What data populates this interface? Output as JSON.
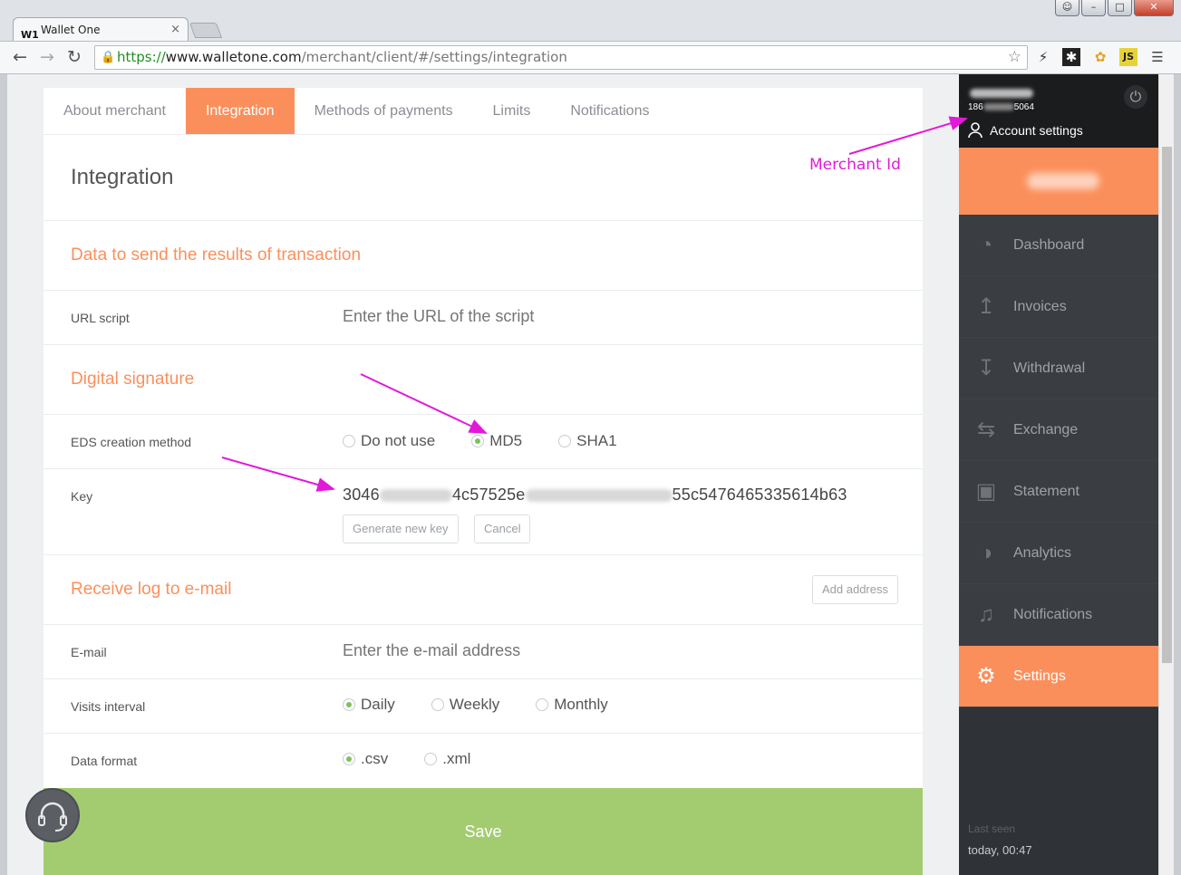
{
  "browser": {
    "tab_title": "Wallet One",
    "url_scheme": "https://",
    "url_host": "www.walletone.com",
    "url_path": "/merchant/client/#/settings/integration"
  },
  "tabs": [
    "About merchant",
    "Integration",
    "Methods of payments",
    "Limits",
    "Notifications"
  ],
  "page_title": "Integration",
  "sections": {
    "transaction": "Data to send the results of transaction",
    "signature": "Digital signature",
    "log": "Receive log to e-mail"
  },
  "url_script": {
    "label": "URL script",
    "placeholder": "Enter the URL of the script"
  },
  "eds": {
    "label": "EDS creation method",
    "options": [
      "Do not use",
      "MD5",
      "SHA1"
    ],
    "selected": "MD5"
  },
  "key": {
    "label": "Key",
    "part1": "3046",
    "part2": "4c57525e",
    "part3": "55c5476465335614b63",
    "generate_btn": "Generate new key",
    "cancel_btn": "Cancel"
  },
  "add_address_btn": "Add address",
  "email": {
    "label": "E-mail",
    "placeholder": "Enter the e-mail address"
  },
  "visits": {
    "label": "Visits interval",
    "options": [
      "Daily",
      "Weekly",
      "Monthly"
    ],
    "selected": "Daily"
  },
  "format": {
    "label": "Data format",
    "options": [
      ".csv",
      ".xml"
    ],
    "selected": ".csv"
  },
  "save_btn": "Save",
  "sidebar": {
    "merchant_id_start": "186",
    "merchant_id_end": "5064",
    "account_settings": "Account settings",
    "items": [
      {
        "label": "Dashboard",
        "icon": "gauge-icon"
      },
      {
        "label": "Invoices",
        "icon": "upload-icon"
      },
      {
        "label": "Withdrawal",
        "icon": "download-icon"
      },
      {
        "label": "Exchange",
        "icon": "exchange-arrows-icon"
      },
      {
        "label": "Statement",
        "icon": "inbox-tray-icon"
      },
      {
        "label": "Analytics",
        "icon": "pie-chart-icon"
      },
      {
        "label": "Notifications",
        "icon": "bell-icon"
      },
      {
        "label": "Settings",
        "icon": "gear-icon"
      }
    ],
    "active": "Settings",
    "last_seen_label": "Last seen",
    "last_seen_value": "today, 00:47"
  },
  "annotation": "Merchant Id",
  "colors": {
    "accent": "#fb8f5b",
    "save": "#a3cc71",
    "sidebar": "#3a3d41",
    "annotation": "#e21ad8"
  }
}
